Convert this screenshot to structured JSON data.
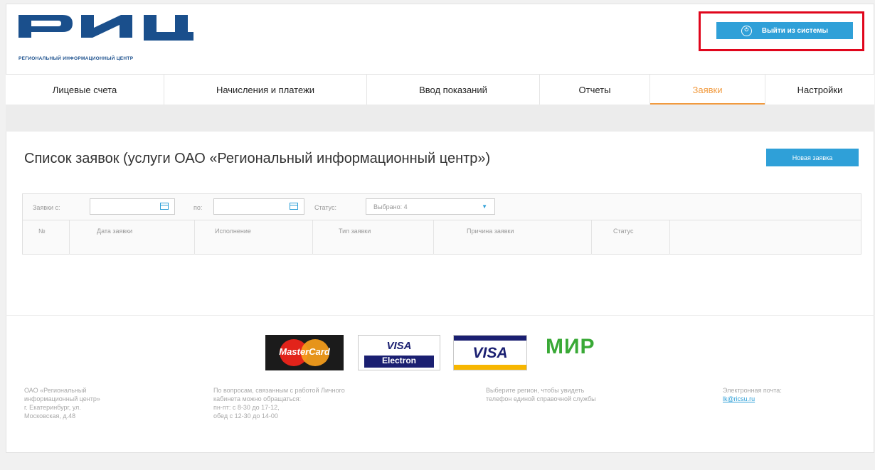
{
  "brand": {
    "logo_text": "РИЦ",
    "tagline": "РЕГИОНАЛЬНЫЙ ИНФОРМАЦИОННЫЙ ЦЕНТР",
    "color": "#1a4f8c"
  },
  "header": {
    "exit_label": "Выйти из системы",
    "exit_icon": "power-icon"
  },
  "nav": {
    "tabs": [
      {
        "label": "Лицевые счета"
      },
      {
        "label": "Начисления и платежи"
      },
      {
        "label": "Ввод показаний"
      },
      {
        "label": "Отчеты"
      },
      {
        "label": "Заявки"
      },
      {
        "label": "Настройки"
      }
    ],
    "active_tab": "Заявки"
  },
  "main": {
    "title": "Список заявок (услуги ОАО «Региональный информационный центр»)",
    "new_request_label": "Новая заявка",
    "filters": {
      "from_label": "Заявки с:",
      "from_value": "",
      "to_label": "по:",
      "to_value": "",
      "status_label": "Статус:",
      "status_value": "Выбрано: 4"
    },
    "table": {
      "columns": [
        "№",
        "Дата заявки",
        "Исполнение",
        "Тип заявки",
        "Причина заявки",
        "Статус"
      ]
    }
  },
  "footer": {
    "cards": {
      "mastercard": "MasterCard",
      "visa_electron_top": "VISA",
      "visa_electron_bottom": "Electron",
      "visa": "VISA",
      "mir": "МИР"
    },
    "company_line1": "ОАО «Региональный",
    "company_line2": "информационный центр»",
    "company_line3": "г. Екатеринбург, ул.",
    "company_line4": "Московская, д.48",
    "support_line1": "По вопросам, связанным с работой Личного",
    "support_line2": "кабинета можно обращаться:",
    "support_line3": "пн-пт: с 8-30 до 17-12,",
    "support_line4": "обед с 12-30 до 14-00",
    "region_line1": "Выберите регион, чтобы увидеть",
    "region_line2": "телефон единой справочной службы",
    "email_label": "Электронная почта:",
    "email_value": "lk@ricsu.ru"
  },
  "colors": {
    "accent": "#2fa0d8",
    "active_tab": "#f19a3e",
    "highlight_border": "#e0061c"
  }
}
